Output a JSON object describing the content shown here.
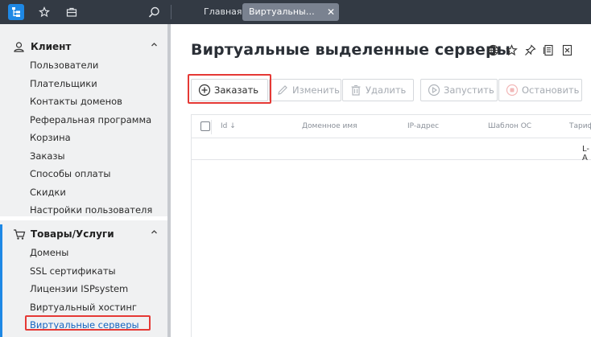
{
  "topbar": {
    "tabs": [
      {
        "label": "Главная"
      },
      {
        "label": "Виртуальные выделенные серверы"
      }
    ],
    "close_glyph": "✕"
  },
  "sidebar": {
    "groups": [
      {
        "title": "Клиент",
        "icon": "person-icon",
        "items": [
          {
            "label": "Пользователи"
          },
          {
            "label": "Плательщики"
          },
          {
            "label": "Контакты доменов"
          },
          {
            "label": "Реферальная программа"
          },
          {
            "label": "Корзина"
          },
          {
            "label": "Заказы"
          },
          {
            "label": "Способы оплаты"
          },
          {
            "label": "Скидки"
          },
          {
            "label": "Настройки пользователя"
          }
        ]
      },
      {
        "title": "Товары/Услуги",
        "icon": "cart-icon",
        "items": [
          {
            "label": "Домены"
          },
          {
            "label": "SSL сертификаты"
          },
          {
            "label": "Лицензии ISPsystem"
          },
          {
            "label": "Виртуальный хостинг"
          },
          {
            "label": "Виртуальные серверы",
            "active": true
          }
        ]
      }
    ]
  },
  "main": {
    "title": "Виртуальные выделенные серверы",
    "toolbar": {
      "order": "Заказать",
      "edit": "Изменить",
      "delete": "Удалить",
      "start": "Запустить",
      "stop": "Остановить"
    },
    "table": {
      "columns": [
        "Id",
        "Доменное имя",
        "IP-адрес",
        "Шаблон ОС",
        "Тариф"
      ],
      "sort_glyph": "↓",
      "row_fragment": "L-A"
    }
  },
  "colors": {
    "accent": "#1e88e5",
    "highlight": "#e53935",
    "topbar": "#333a44"
  }
}
